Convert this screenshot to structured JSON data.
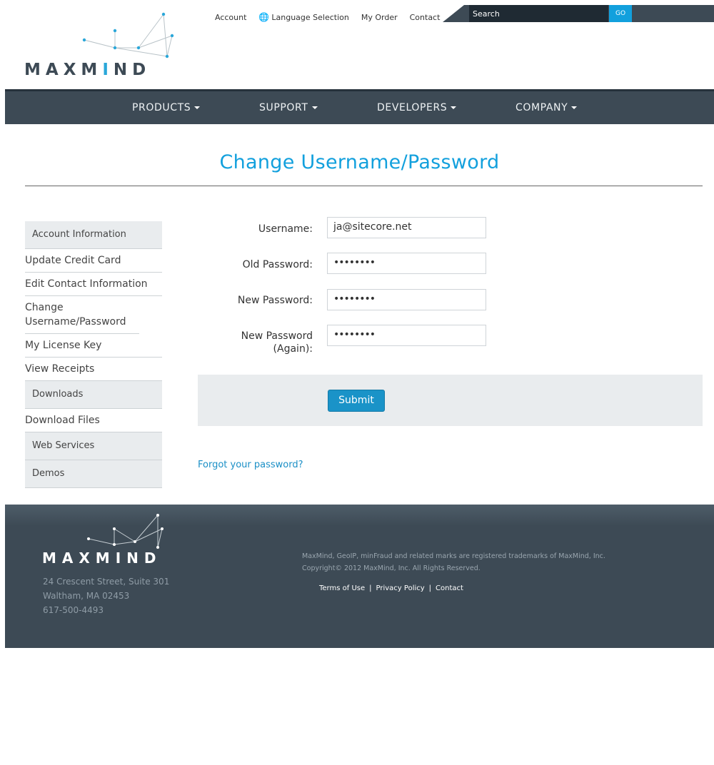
{
  "header": {
    "logo_text_a": "MAXM",
    "logo_text_b": "I",
    "logo_text_c": "ND",
    "topnav": [
      "Account",
      "Language Selection",
      "My Order",
      "Contact"
    ],
    "search_label": "Search",
    "go_label": "GO"
  },
  "mainnav": [
    "PRODUCTS",
    "SUPPORT",
    "DEVELOPERS",
    "COMPANY"
  ],
  "page_title": "Change Username/Password",
  "sidebar": {
    "account_head": "Account Information",
    "account_items": [
      "Update Credit Card",
      "Edit Contact Information",
      "Change Username/Password",
      "My License Key",
      "View Receipts"
    ],
    "downloads_head": "Downloads",
    "downloads_items": [
      "Download Files"
    ],
    "webservices_head": "Web Services",
    "demos_head": "Demos"
  },
  "form": {
    "username_label": "Username:",
    "username_value": "ja@sitecore.net",
    "old_pw_label": "Old Password:",
    "new_pw_label": "New Password:",
    "new_pw_again_label_1": "New Password",
    "new_pw_again_label_2": "(Again):",
    "masked": "••••••••",
    "submit_label": "Submit",
    "forgot_link": "Forgot your password?"
  },
  "footer": {
    "logo_text": "MAXMIND",
    "address_1": "24 Crescent Street, Suite 301",
    "address_2": "Waltham, MA 02453",
    "phone": "617-500-4493",
    "trademark": "MaxMind, GeoIP, minFraud and related marks are registered trademarks of MaxMind, Inc.",
    "copyright": "Copyright© 2012 MaxMind, Inc. All Rights Reserved.",
    "links": [
      "Terms of Use",
      "Privacy Policy",
      "Contact"
    ]
  },
  "colors": {
    "accent": "#12a0dd",
    "nav_bg": "#3d4a55",
    "sidebar_head_bg": "#e9ecee"
  }
}
